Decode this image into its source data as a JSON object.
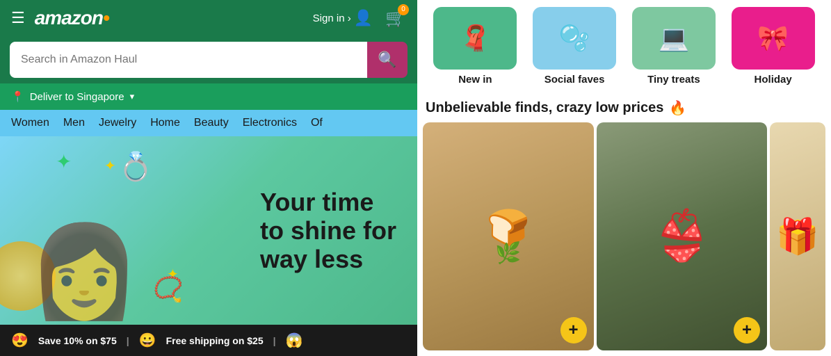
{
  "header": {
    "logo": "amazon",
    "logo_accent": "●",
    "signin_label": "Sign in ›",
    "cart_count": "0",
    "search_placeholder": "Search in Amazon Haul",
    "search_icon": "🔍",
    "deliver_label": "Deliver to Singapore",
    "deliver_icon": "📍"
  },
  "nav": {
    "categories": [
      "Women",
      "Men",
      "Jewelry",
      "Home",
      "Beauty",
      "Electronics",
      "Of"
    ]
  },
  "banner": {
    "line1": "Your time",
    "line2": "to shine for",
    "line3": "way less"
  },
  "bottom_bar": {
    "item1_emoji": "😍",
    "item1_text": "Save 10% on $75",
    "separator1": "|",
    "item2_emoji": "😀",
    "item2_text": "Free shipping on $25",
    "separator2": "|",
    "item3_emoji": "😱"
  },
  "right": {
    "category_tiles": [
      {
        "id": "new-in",
        "label": "New in",
        "emoji": "🧣",
        "bg": "green-bg"
      },
      {
        "id": "social-faves",
        "label": "Social faves",
        "emoji": "🫧",
        "bg": "blue-bg"
      },
      {
        "id": "tiny-treats",
        "label": "Tiny treats",
        "emoji": "💻",
        "bg": "green2-bg"
      },
      {
        "id": "holiday",
        "label": "Holiday",
        "emoji": "🎀",
        "bg": "pink-bg"
      }
    ],
    "section_heading": "Unbelievable finds, crazy low prices",
    "section_emoji": "🔥",
    "products": [
      {
        "id": "food",
        "emoji": "🍞",
        "bg": "food-bg"
      },
      {
        "id": "fashion",
        "emoji": "👙",
        "bg": "fashion-bg"
      },
      {
        "id": "gift",
        "emoji": "🎁",
        "bg": "gift-bg"
      }
    ],
    "add_button_label": "+"
  }
}
